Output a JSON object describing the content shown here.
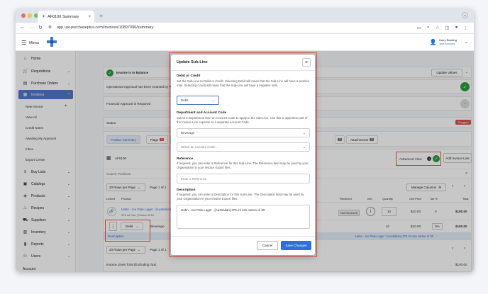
{
  "browser": {
    "tab_title": "AF0100 Summary",
    "url": "app.uat-purchaseplus.com/invoices/10897096/summary"
  },
  "header": {
    "menu_label": "Menu",
    "user_name": "Harry Basking",
    "user_account": "Test Account"
  },
  "sidebar": {
    "items": [
      {
        "label": "Home",
        "icon": "home-icon"
      },
      {
        "label": "Requisitions",
        "icon": "cart-icon"
      },
      {
        "label": "Purchase Orders",
        "icon": "document-icon"
      },
      {
        "label": "Invoices",
        "icon": "invoice-icon"
      },
      {
        "label": "Buy Lists",
        "icon": "list-icon"
      },
      {
        "label": "Catalogs",
        "icon": "catalog-icon"
      },
      {
        "label": "Products",
        "icon": "box-icon"
      },
      {
        "label": "Recipes",
        "icon": "chef-icon"
      },
      {
        "label": "Suppliers",
        "icon": "truck-icon"
      },
      {
        "label": "Inventory",
        "icon": "inventory-icon"
      },
      {
        "label": "Reports",
        "icon": "chart-icon"
      },
      {
        "label": "Users",
        "icon": "user-icon"
      },
      {
        "label": "Account",
        "icon": ""
      }
    ],
    "sub_items": [
      "New Invoice",
      "View All",
      "Credit Notes",
      "Awaiting My Approval",
      "Inbox",
      "Export Center"
    ]
  },
  "main": {
    "balance_text": "Invoice is in Balance",
    "update_values": "Update Values",
    "operational_approval": "Operational Approval has been Granted by Peter W",
    "financial_approval": "Financial Approval is Required",
    "status_label": "Status",
    "status_value": "Flagged",
    "tabs": [
      {
        "label": "Product Summary"
      },
      {
        "label": "Flags",
        "badge": "1"
      },
      {
        "label": "Analy"
      },
      {
        "label": "Attachments",
        "badge": "0"
      }
    ],
    "hidden_badge": "3",
    "invoice_code": "AF0100",
    "advanced_view": "Advanced View",
    "add_invoice_line": "Add Invoice Line",
    "search_placeholder": "Search Products",
    "per_page": "20 Rows per Page",
    "page_of": "Page 1 of 1",
    "manage_columns": "Manage Columns",
    "columns": [
      "Linked",
      "Product",
      "Received",
      "Info",
      "Quantity",
      "Unit Price",
      "Tax %",
      "Total"
    ],
    "row": {
      "product_name": "Hahn - Ice Pale Lager : [Australian]",
      "product_desc": "375 ml Can | Carton of 30",
      "received": "Not Received",
      "quantity": "10",
      "unit_price": "$10.00",
      "tax": "0",
      "total": "$100.00"
    },
    "subline": {
      "type": "Debit",
      "department": "Beverage",
      "quantity": "10",
      "unit_price": "$10.00",
      "tax": "0%",
      "total": "$100.00",
      "description_label": "Description",
      "description_value": "Hahn - Ice Pale Lager : [Australian] 375 ml can carton of 30"
    },
    "footer_text": "Invoice Lines Total (Excluding Tax)",
    "footer_value": "$100.00"
  },
  "modal": {
    "title": "Update Sub-Line",
    "debit_label": "Debit or Credit",
    "debit_help": "Set the Sub-Line to Debit or Credit. Selecting Debit will mean that the Sub-Line will have a positive total. Selecting Credit will mean that the Sub-Line will have a negative total.",
    "debit_value": "Debit",
    "dept_label": "Department and Account Code",
    "dept_help": "Select a Department then an Account Code to apply to the Sub-Line. Use this to apportion part of the Invoice Line expense to a separate Account Code.",
    "dept_value": "Beverage",
    "account_placeholder": "Select an Account Code...",
    "reference_label": "Reference",
    "reference_help": "If required, you can enter a Reference for this Sub-Line. The Reference field may be used by your Organisation in your Invoice Export files.",
    "reference_placeholder": "Enter a Reference",
    "description_label": "Description",
    "description_help": "If required, you can enter a Description for this Sub-Line. The Description field may be used by your Organisation in your Invoice Export files.",
    "description_value": "Hahn - Ice Pale Lager : [Australian] 375 ml can carton of 30",
    "cancel": "Cancel",
    "save": "Save Changes"
  }
}
